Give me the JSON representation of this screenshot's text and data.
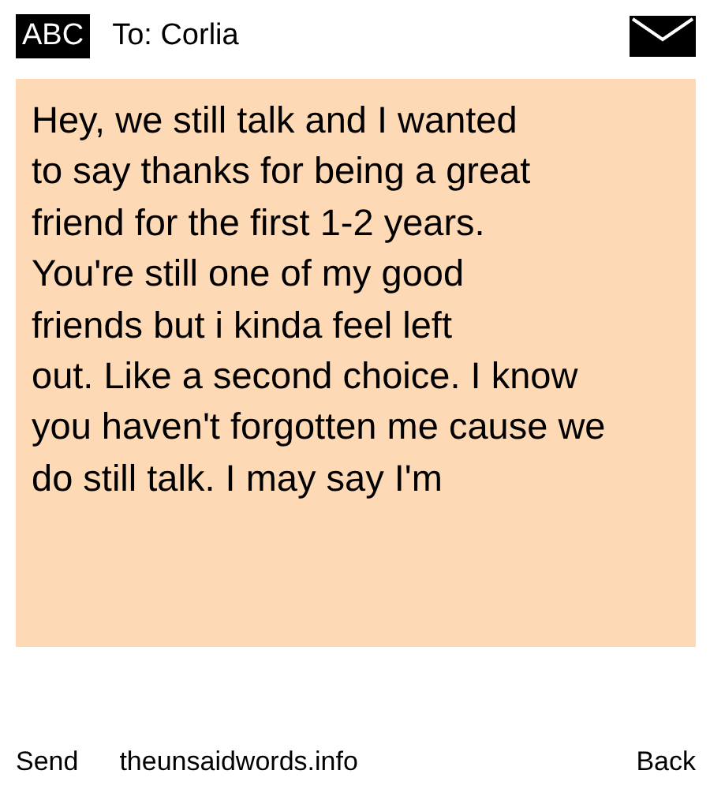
{
  "header": {
    "mode": "ABC",
    "recipient": "To: Corlia"
  },
  "message": {
    "lines": [
      "Hey, we still talk and I wanted",
      "to say thanks for being a great",
      "friend for the first 1-2 years.",
      "You're still one of my good",
      "friends but i kinda feel left",
      "out. Like a second choice. I know",
      "you haven't forgotten me cause we",
      "do still talk. I may say I'm"
    ]
  },
  "softkeys": {
    "left": "Send",
    "center": "theunsaidwords.info",
    "right": "Back"
  }
}
